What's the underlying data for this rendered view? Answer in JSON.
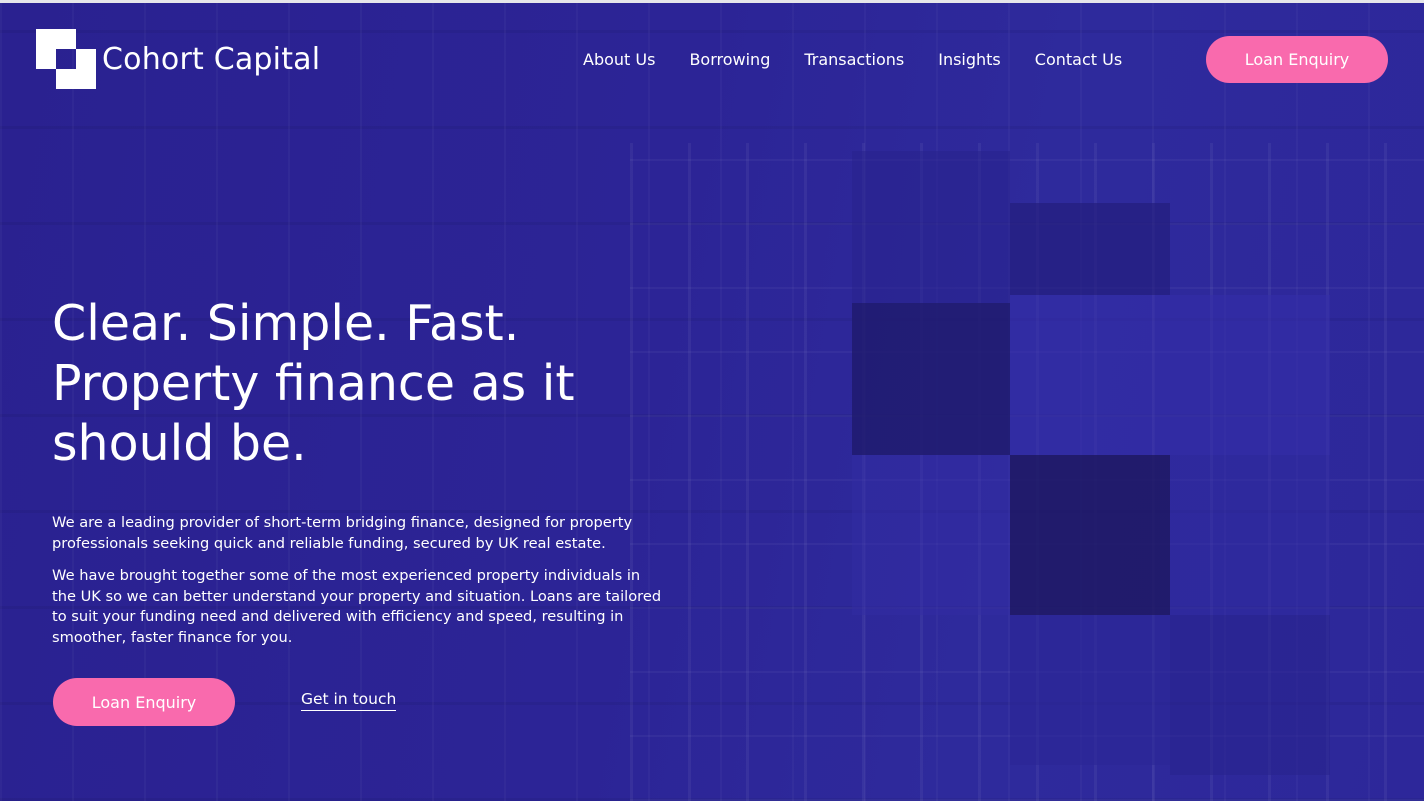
{
  "brand": {
    "name": "Cohort Capital"
  },
  "nav": {
    "items": [
      {
        "label": "About Us"
      },
      {
        "label": "Borrowing"
      },
      {
        "label": "Transactions"
      },
      {
        "label": "Insights"
      },
      {
        "label": "Contact Us"
      }
    ]
  },
  "header": {
    "cta_label": "Loan Enquiry"
  },
  "hero": {
    "headline_line1": "Clear. Simple. Fast.",
    "headline_line2": "Property finance as it",
    "headline_line3": "should be.",
    "paragraph1": "We are a leading provider of short-term bridging finance, designed for property professionals seeking quick and reliable funding, secured by UK real estate.",
    "paragraph2": "We have brought together some of the most experienced property individuals in the UK so we can better understand your property and situation. Loans are tailored to suit your funding need and delivered with efficiency and speed, resulting in smoother, faster finance for you.",
    "primary_cta": "Loan Enquiry",
    "secondary_cta": "Get in touch"
  },
  "colors": {
    "background": "#2b2390",
    "accent": "#f96aad",
    "text": "#ffffff"
  }
}
